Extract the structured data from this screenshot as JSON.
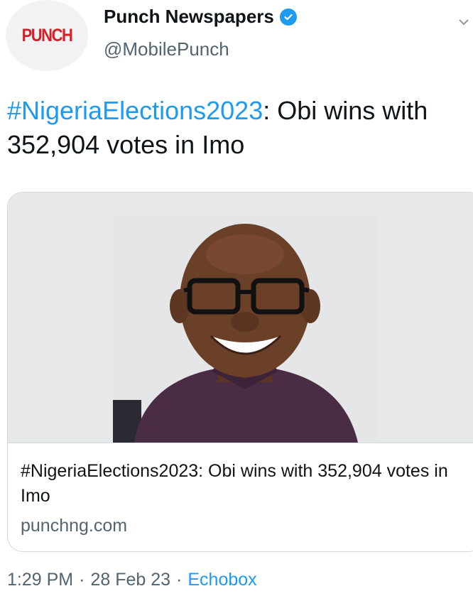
{
  "author": {
    "logo_text": "PUNCH",
    "display_name": "Punch Newspapers",
    "handle": "@MobilePunch",
    "verified_icon": "verified-badge-icon",
    "colors": {
      "logo": "#d4202a",
      "verified": "#1d9bf0"
    }
  },
  "tweet": {
    "hashtag": "#NigeriaElections2023",
    "text_rest": ": Obi wins with 352,904 votes in Imo"
  },
  "card": {
    "title": "#NigeriaElections2023: Obi wins with 352,904 votes in Imo",
    "domain": "punchng.com"
  },
  "meta": {
    "time": "1:29 PM",
    "sep1": "·",
    "date": "28 Feb 23",
    "sep2": "·",
    "source": "Echobox"
  },
  "colors": {
    "link": "#1d9bf0",
    "muted": "#536471",
    "text": "#0f1419"
  }
}
